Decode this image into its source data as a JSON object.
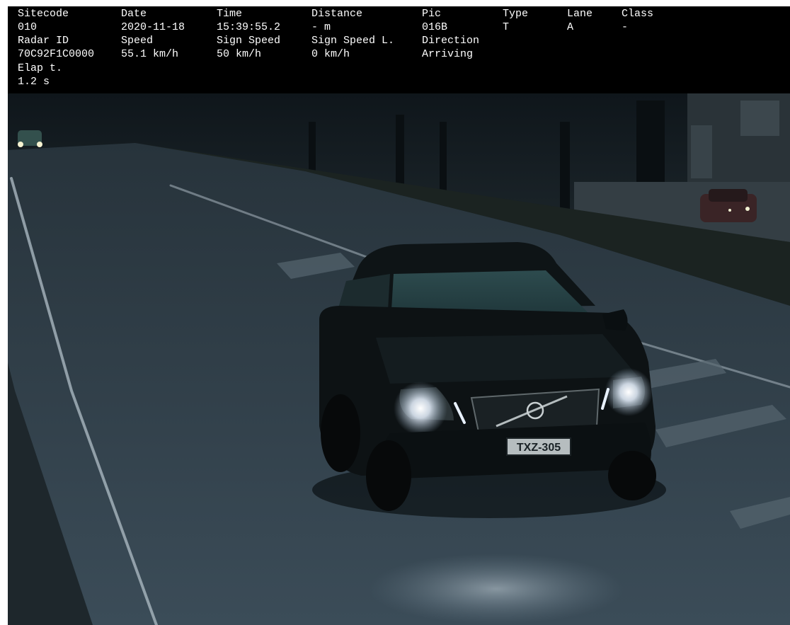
{
  "overlay": {
    "row1": {
      "sitecode_label": "Sitecode",
      "date_label": "Date",
      "time_label": "Time",
      "distance_label": "Distance",
      "pic_label": "Pic",
      "type_label": "Type",
      "lane_label": "Lane",
      "class_label": "Class"
    },
    "row2": {
      "sitecode": "010",
      "date": "2020-11-18",
      "time": "15:39:55.2",
      "distance": "- m",
      "pic": "016B",
      "type": "T",
      "lane": "A",
      "class": "-"
    },
    "row3": {
      "radar_id_label": "Radar ID",
      "speed_label": "Speed",
      "sign_speed_label": "Sign Speed",
      "sign_speed_l_label": "Sign Speed L.",
      "direction_label": "Direction"
    },
    "row4": {
      "radar_id": "70C92F1C0000",
      "speed": "55.1 km/h",
      "sign_speed": "50 km/h",
      "sign_speed_l": "0 km/h",
      "direction": "Arriving"
    },
    "row5": {
      "elapsed_label": "Elap t."
    },
    "row6": {
      "elapsed": "1.2 s"
    }
  },
  "scene": {
    "license_plate": "TXZ-305"
  }
}
